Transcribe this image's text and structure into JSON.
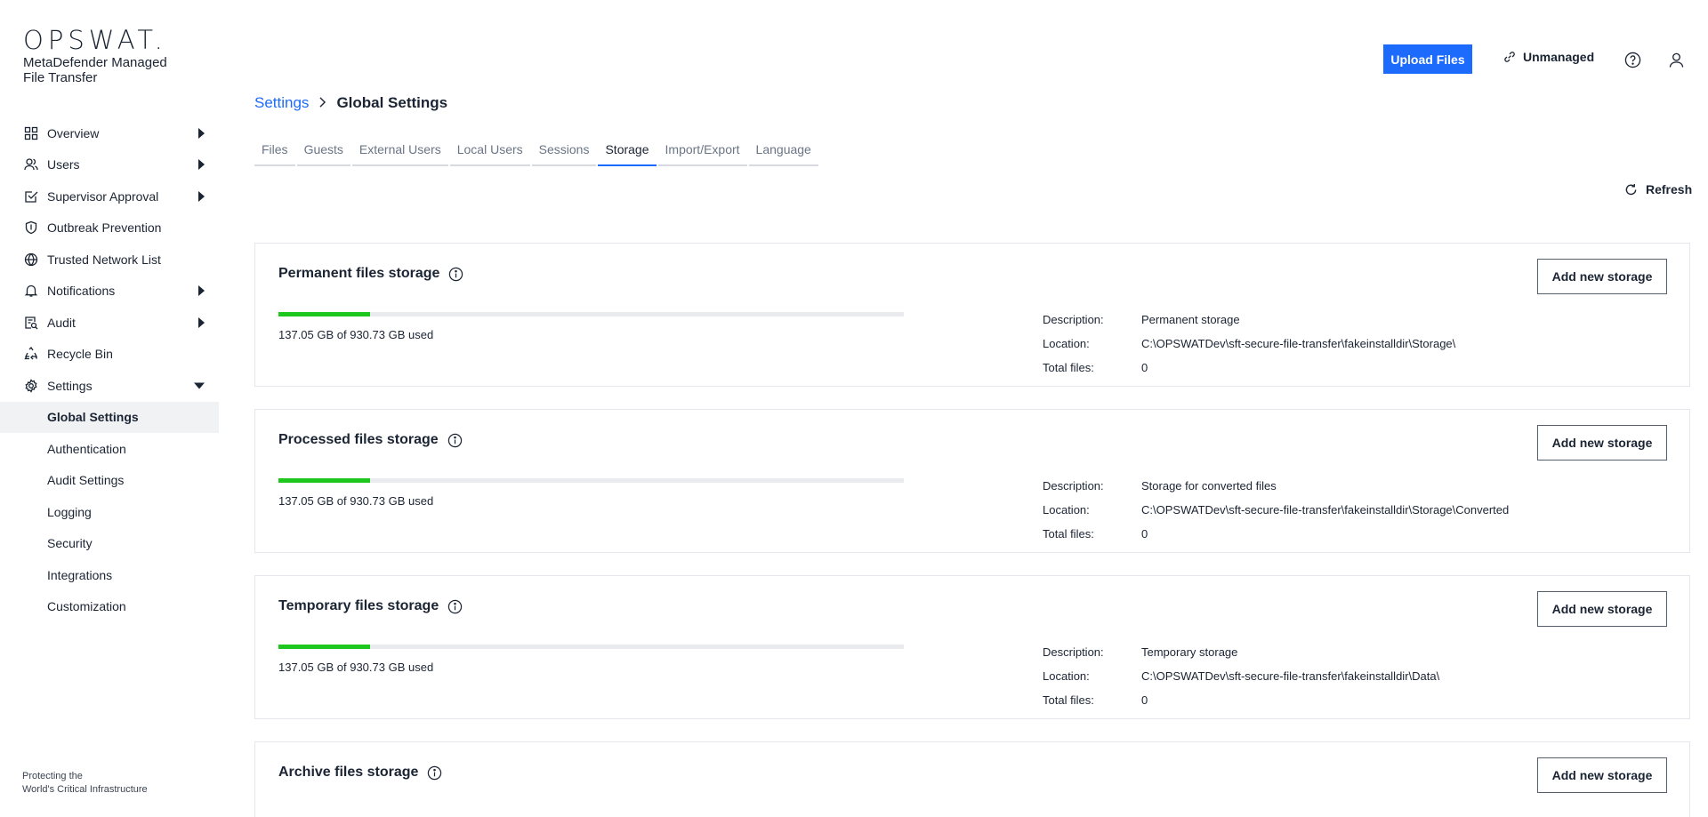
{
  "brand": {
    "logo": "OPSWAT.",
    "product": "MetaDefender Managed File Transfer",
    "tagline_line1": "Protecting the",
    "tagline_line2": "World's Critical Infrastructure"
  },
  "sidebar": {
    "items": [
      {
        "label": "Overview",
        "icon": "grid-icon",
        "caret": "right"
      },
      {
        "label": "Users",
        "icon": "users-icon",
        "caret": "right"
      },
      {
        "label": "Supervisor Approval",
        "icon": "checkbox-icon",
        "caret": "right"
      },
      {
        "label": "Outbreak Prevention",
        "icon": "shield-icon",
        "caret": ""
      },
      {
        "label": "Trusted Network List",
        "icon": "globe-icon",
        "caret": ""
      },
      {
        "label": "Notifications",
        "icon": "bell-icon",
        "caret": "right"
      },
      {
        "label": "Audit",
        "icon": "audit-icon",
        "caret": "right"
      },
      {
        "label": "Recycle Bin",
        "icon": "recycle-icon",
        "caret": ""
      },
      {
        "label": "Settings",
        "icon": "gear-icon",
        "caret": "down"
      }
    ],
    "sub_items": [
      {
        "label": "Global Settings",
        "active": true
      },
      {
        "label": "Authentication"
      },
      {
        "label": "Audit Settings"
      },
      {
        "label": "Logging"
      },
      {
        "label": "Security"
      },
      {
        "label": "Integrations"
      },
      {
        "label": "Customization"
      }
    ]
  },
  "header": {
    "upload_label": "Upload Files",
    "unmanaged_label": "Unmanaged",
    "accent": "#1d6bfc"
  },
  "breadcrumb": {
    "parent": "Settings",
    "current": "Global Settings"
  },
  "tabs": [
    {
      "label": "Files"
    },
    {
      "label": "Guests"
    },
    {
      "label": "External Users"
    },
    {
      "label": "Local Users"
    },
    {
      "label": "Sessions"
    },
    {
      "label": "Storage",
      "active": true
    },
    {
      "label": "Import/Export"
    },
    {
      "label": "Language"
    }
  ],
  "refresh_label": "Refresh",
  "labels": {
    "add_storage": "Add new storage",
    "description": "Description:",
    "location": "Location:",
    "total_files": "Total files:"
  },
  "storages": [
    {
      "title": "Permanent files storage",
      "usage": "137.05 GB of 930.73 GB used",
      "used_fraction": 0.147,
      "description": "Permanent storage",
      "location": "C:\\OPSWATDev\\sft-secure-file-transfer\\fakeinstalldir\\Storage\\",
      "total_files": "0"
    },
    {
      "title": "Processed files storage",
      "usage": "137.05 GB of 930.73 GB used",
      "used_fraction": 0.147,
      "description": "Storage for converted files",
      "location": "C:\\OPSWATDev\\sft-secure-file-transfer\\fakeinstalldir\\Storage\\Converted",
      "total_files": "0"
    },
    {
      "title": "Temporary files storage",
      "usage": "137.05 GB of 930.73 GB used",
      "used_fraction": 0.147,
      "description": "Temporary storage",
      "location": "C:\\OPSWATDev\\sft-secure-file-transfer\\fakeinstalldir\\Data\\",
      "total_files": "0"
    },
    {
      "title": "Archive files storage"
    }
  ],
  "colors": {
    "usage_bar": "#1ec71e",
    "bar_track": "#e9ebee"
  }
}
